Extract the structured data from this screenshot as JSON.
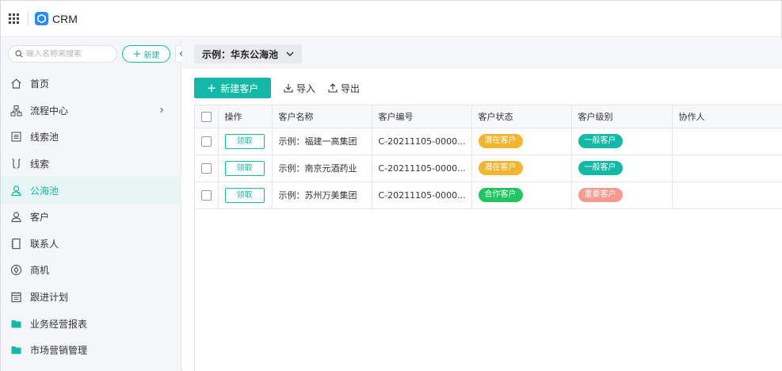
{
  "app": {
    "title": "CRM"
  },
  "sidebar": {
    "search_placeholder": "输入名称来搜索",
    "new_label": "新建",
    "collapse_symbol": "«",
    "items": [
      {
        "label": "首页",
        "icon": "home-icon"
      },
      {
        "label": "流程中心",
        "icon": "flow-icon",
        "has_arrow": true
      },
      {
        "label": "线索池",
        "icon": "lead-pool-icon"
      },
      {
        "label": "线索",
        "icon": "lead-icon"
      },
      {
        "label": "公海池",
        "icon": "public-pool-icon",
        "active": true
      },
      {
        "label": "客户",
        "icon": "customer-icon"
      },
      {
        "label": "联系人",
        "icon": "contact-icon"
      },
      {
        "label": "商机",
        "icon": "opportunity-icon"
      },
      {
        "label": "跟进计划",
        "icon": "plan-icon"
      },
      {
        "label": "业务经营报表",
        "icon": "folder-icon"
      },
      {
        "label": "市场营销管理",
        "icon": "folder-icon"
      }
    ]
  },
  "main": {
    "pool_selector": "示例：华东公海池",
    "toolbar": {
      "new_customer": "新建客户",
      "import": "导入",
      "export": "导出"
    },
    "table": {
      "columns": [
        "操作",
        "客户名称",
        "客户编号",
        "客户状态",
        "客户级别",
        "协作人"
      ],
      "claim_label": "领取",
      "rows": [
        {
          "name": "示例：福建一高集团",
          "code": "C-20211105-0000...",
          "status": "潜在客户",
          "level": "一般客户"
        },
        {
          "name": "示例：南京元酒药业",
          "code": "C-20211105-0000...",
          "status": "潜在客户",
          "level": "一般客户"
        },
        {
          "name": "示例：苏州万美集团",
          "code": "C-20211105-0000...",
          "status": "合作客户",
          "level": "重要客户"
        }
      ]
    }
  },
  "colors": {
    "accent": "#14b8a6",
    "status_potential": "#f2b52f",
    "status_cooperating": "#22c55e",
    "level_normal": "#14b8a6",
    "level_important": "#f59a8e"
  }
}
